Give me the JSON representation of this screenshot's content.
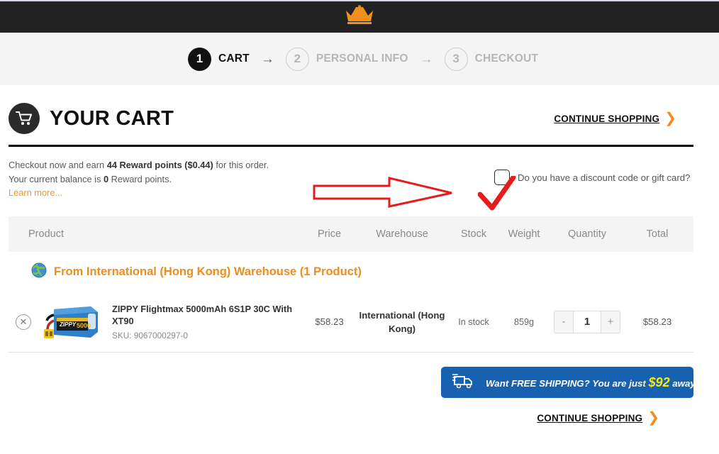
{
  "header": {
    "logo_icon": "crown-icon",
    "background_color": "#222222",
    "logo_color": "#f0901e"
  },
  "steps": {
    "items": [
      {
        "number": "1",
        "label": "CART",
        "state": "active"
      },
      {
        "number": "2",
        "label": "PERSONAL INFO",
        "state": "inactive"
      },
      {
        "number": "3",
        "label": "CHECKOUT",
        "state": "inactive"
      }
    ],
    "separator": "→"
  },
  "cart": {
    "icon": "shopping-cart-icon",
    "title": "YOUR CART",
    "continue_shopping": "CONTINUE SHOPPING",
    "chevron": "❯"
  },
  "rewards": {
    "line1_pre": "Checkout now and earn ",
    "line1_bold": "44 Reward points ($0.44)",
    "line1_post": " for this order.",
    "line2_pre": "Your current balance is ",
    "line2_bold": "0",
    "line2_post": " Reward points.",
    "learn_more": "Learn more..."
  },
  "discount": {
    "label": "Do you have a discount code or gift card?",
    "checked": false
  },
  "annotations": {
    "arrow_color": "#e61c1c",
    "check_color": "#e61c1c"
  },
  "table": {
    "columns": [
      "Product",
      "Price",
      "Warehouse",
      "Stock",
      "Weight",
      "Quantity",
      "Total"
    ],
    "group": {
      "icon": "globe-icon",
      "title": "From International (Hong Kong) Warehouse (1 Product)",
      "color": "#f08c1e"
    },
    "rows": [
      {
        "remove_icon": "remove-circle-icon",
        "thumbnail": "lipo-battery-image",
        "name": "ZIPPY Flightmax 5000mAh 6S1P 30C With XT90",
        "sku": "SKU: 9067000297-0",
        "price": "$58.23",
        "warehouse": "International (Hong Kong)",
        "stock": "In stock",
        "weight": "859g",
        "qty_minus": "-",
        "qty_value": "1",
        "qty_plus": "+",
        "total": "$58.23"
      }
    ]
  },
  "shipping_banner": {
    "icon": "delivery-truck-icon",
    "text_pre": "Want FREE SHIPPING? You are just ",
    "amount": "$92",
    "text_post": " away !",
    "background_color": "#1860b0",
    "amount_color": "#f5ec0c"
  },
  "footer": {
    "continue_shopping": "CONTINUE SHOPPING",
    "chevron": "❯"
  }
}
